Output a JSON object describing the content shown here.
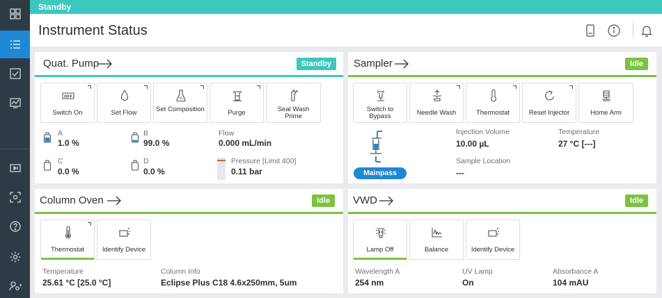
{
  "status_bar": {
    "text": "Standby"
  },
  "header": {
    "title": "Instrument Status"
  },
  "icons": {
    "rail": [
      "dashboard-icon",
      "list-icon",
      "checklist-icon",
      "chart-icon",
      "play-icon",
      "camera-focus-icon",
      "help-icon",
      "settings-icon",
      "user-settings-icon"
    ],
    "header": [
      "phone-icon",
      "info-icon",
      "bell-icon"
    ]
  },
  "colors": {
    "teal": "#3cc7bf",
    "green": "#7cc33f",
    "blue": "#1f88d6",
    "rail": "#2e3b45"
  },
  "pump": {
    "title": "Quat. Pump",
    "status": "Standby",
    "actions": [
      {
        "label": "Switch On",
        "icon": "off-switch-icon"
      },
      {
        "label": "Set Flow",
        "icon": "drop-icon"
      },
      {
        "label": "Set Composition",
        "icon": "flask-percent-icon"
      },
      {
        "label": "Purge",
        "icon": "purge-icon"
      },
      {
        "label": "Seal Wash Prime",
        "icon": "seal-wash-icon"
      }
    ],
    "solvents": [
      {
        "label": "A",
        "value": "1.0 %"
      },
      {
        "label": "B",
        "value": "99.0 %"
      },
      {
        "label": "C",
        "value": "0.0 %"
      },
      {
        "label": "D",
        "value": "0.0 %"
      }
    ],
    "flow_label": "Flow",
    "flow_value": "0.000 mL/min",
    "pressure_label": "Pressure [Limit 400]",
    "pressure_value": "0.11 bar"
  },
  "sampler": {
    "title": "Sampler",
    "status": "Idle",
    "actions": [
      {
        "label": "Switch to Bypass",
        "icon": "valve-icon"
      },
      {
        "label": "Needle Wash",
        "icon": "needle-wash-icon"
      },
      {
        "label": "Thermostat",
        "icon": "thermometer-icon"
      },
      {
        "label": "Reset Injector",
        "icon": "reset-icon"
      },
      {
        "label": "Home Arm",
        "icon": "robot-arm-icon"
      }
    ],
    "injection_label": "Injection Volume",
    "injection_value": "10.00 µL",
    "temperature_label": "Temperature",
    "temperature_value": "27 °C  [---]",
    "location_label": "Sample Location",
    "location_value": "---",
    "mode": "Mainpass"
  },
  "oven": {
    "title": "Column Oven",
    "status": "Idle",
    "actions": [
      {
        "label": "Thermostat",
        "icon": "thermometer-icon"
      },
      {
        "label": "Identify Device",
        "icon": "identify-device-icon"
      }
    ],
    "temperature_label": "Temperature",
    "temperature_value": "25.61 °C  [25.0 °C]",
    "column_label": "Column Info",
    "column_value": "Eclipse Plus C18 4.6x250mm, 5um"
  },
  "vwd": {
    "title": "VWD",
    "status": "Idle",
    "actions": [
      {
        "label": "Lamp Off",
        "icon": "lamp-icon"
      },
      {
        "label": "Balance",
        "icon": "balance-icon"
      },
      {
        "label": "Identify Device",
        "icon": "identify-device-icon"
      }
    ],
    "wavelength_label": "Wavelength A",
    "wavelength_value": "254 nm",
    "lamp_label": "UV Lamp",
    "lamp_value": "On",
    "absorbance_label": "Absorbance A",
    "absorbance_value": "104 mAU"
  }
}
